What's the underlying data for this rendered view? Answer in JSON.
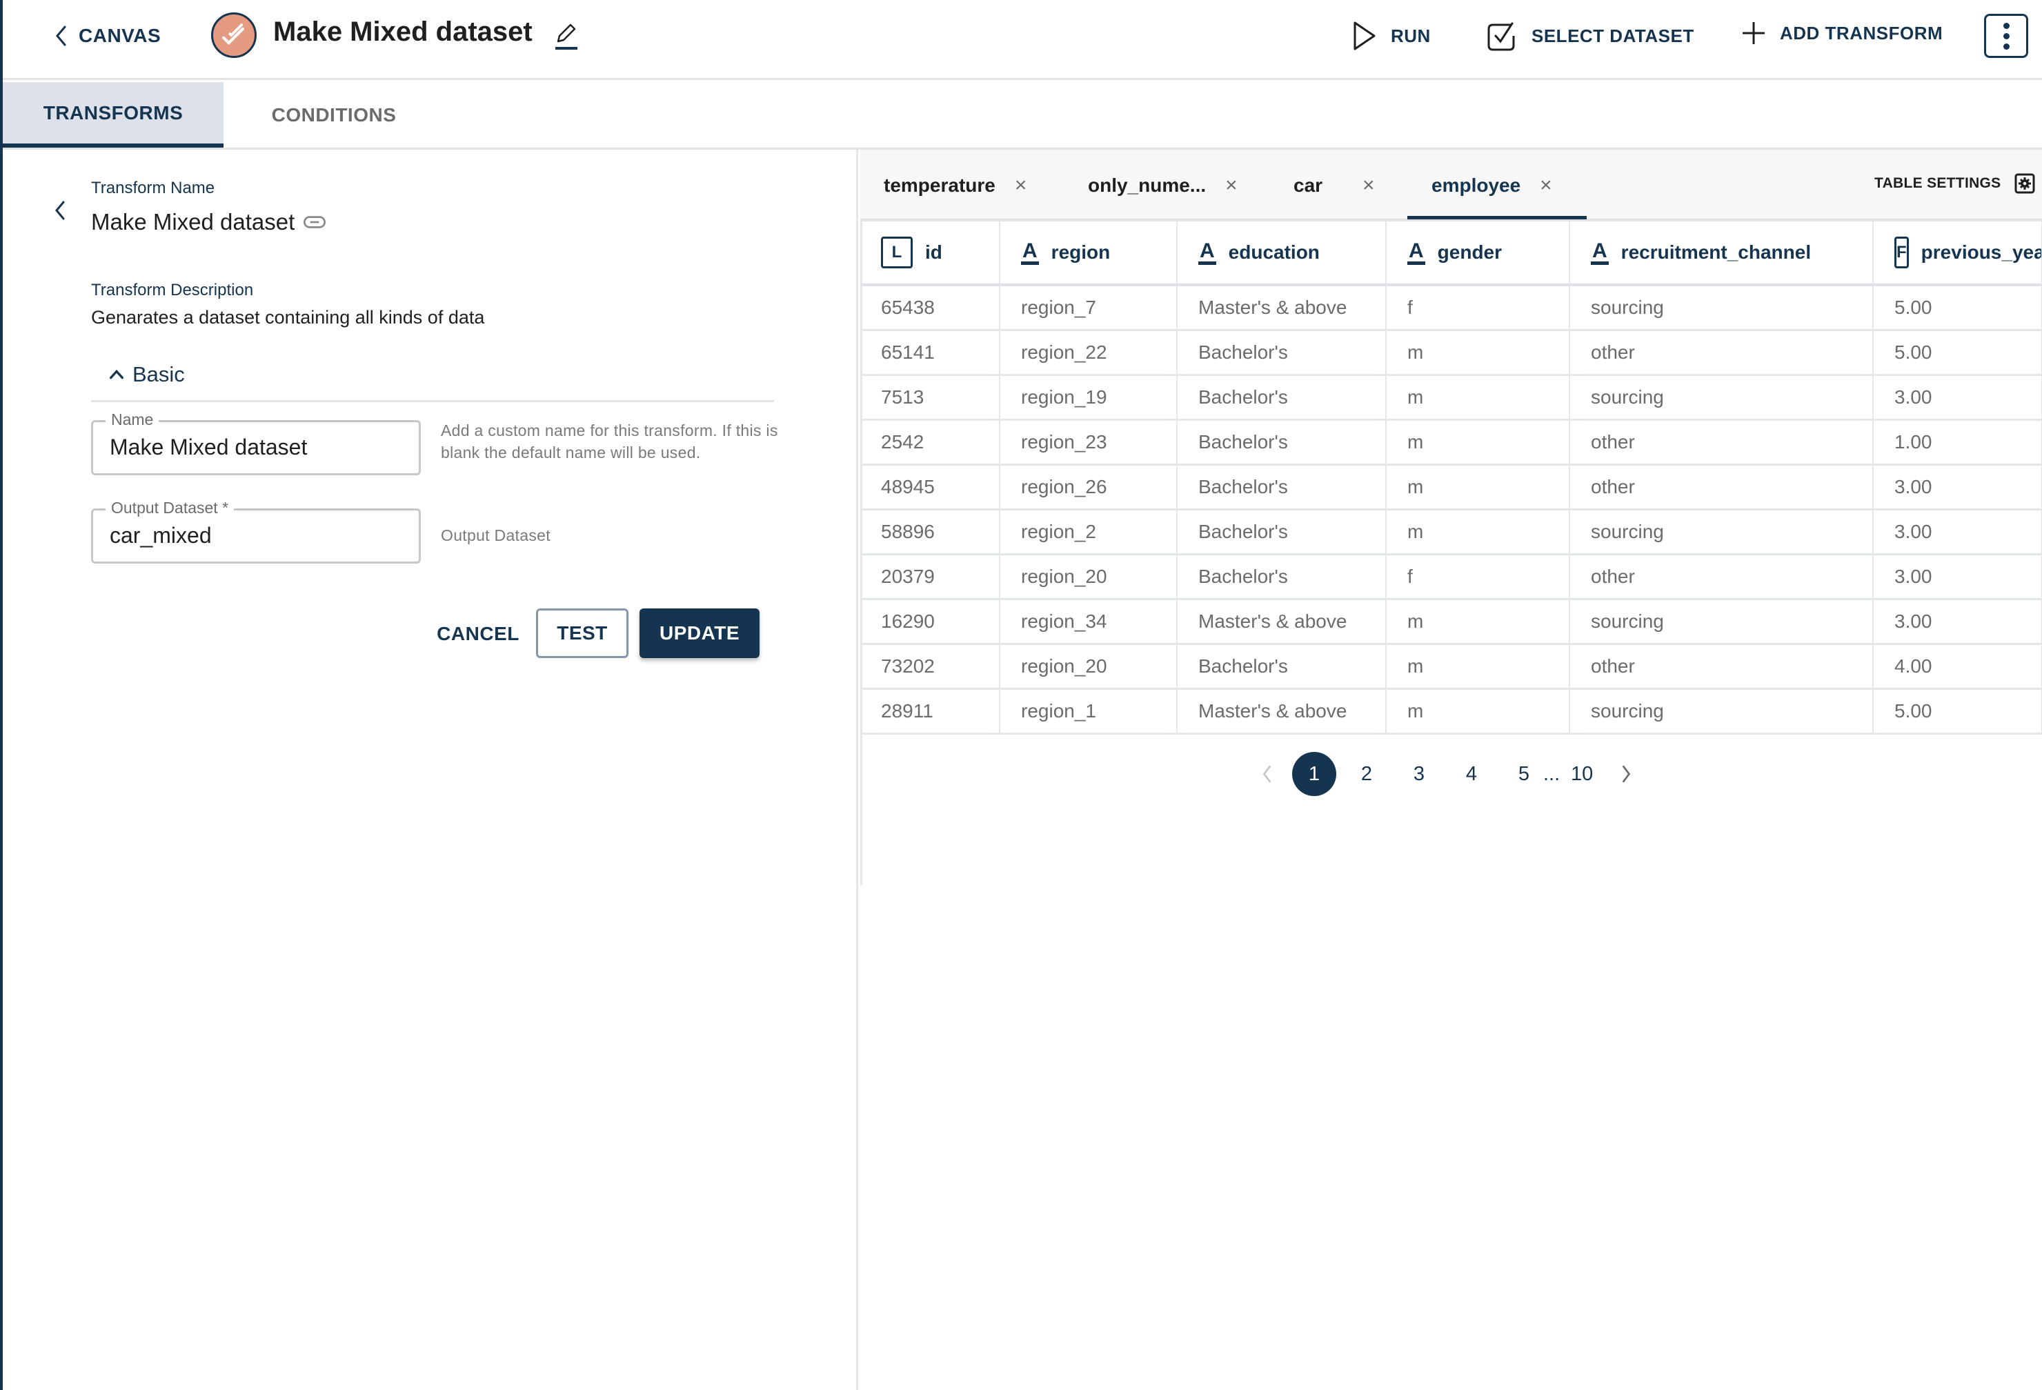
{
  "header": {
    "back_label": "CANVAS",
    "title": "Make Mixed dataset",
    "actions": {
      "run": "RUN",
      "select_dataset": "SELECT DATASET",
      "add_transform": "ADD TRANSFORM"
    },
    "logo_color": "#e59a82",
    "accent_color": "#15344f"
  },
  "main_tabs": [
    {
      "label": "TRANSFORMS",
      "active": true
    },
    {
      "label": "CONDITIONS",
      "active": false
    }
  ],
  "transform": {
    "name_label": "Transform Name",
    "name_value": "Make Mixed dataset",
    "description_label": "Transform Description",
    "description_value": "Genarates a dataset containing all kinds of data",
    "section_label": "Basic",
    "fields": {
      "name": {
        "label": "Name",
        "value": "Make Mixed dataset",
        "helper": "Add a custom name for this transform. If this is blank the default name will be used."
      },
      "output_dataset": {
        "label": "Output Dataset *",
        "value": "car_mixed",
        "helper": "Output Dataset"
      }
    },
    "buttons": {
      "cancel": "CANCEL",
      "test": "TEST",
      "update": "UPDATE"
    }
  },
  "dataset_tabs": [
    {
      "label": "temperature",
      "active": false
    },
    {
      "label": "only_nume...",
      "active": false
    },
    {
      "label": "car",
      "active": false
    },
    {
      "label": "employee",
      "active": true
    }
  ],
  "table_settings_label": "TABLE SETTINGS",
  "table": {
    "columns": [
      {
        "name": "id",
        "type": "L"
      },
      {
        "name": "region",
        "type": "A"
      },
      {
        "name": "education",
        "type": "A"
      },
      {
        "name": "gender",
        "type": "A"
      },
      {
        "name": "recruitment_channel",
        "type": "A"
      },
      {
        "name": "previous_yea",
        "type": "F"
      }
    ],
    "rows": [
      [
        "65438",
        "region_7",
        "Master's & above",
        "f",
        "sourcing",
        "5.00"
      ],
      [
        "65141",
        "region_22",
        "Bachelor's",
        "m",
        "other",
        "5.00"
      ],
      [
        "7513",
        "region_19",
        "Bachelor's",
        "m",
        "sourcing",
        "3.00"
      ],
      [
        "2542",
        "region_23",
        "Bachelor's",
        "m",
        "other",
        "1.00"
      ],
      [
        "48945",
        "region_26",
        "Bachelor's",
        "m",
        "other",
        "3.00"
      ],
      [
        "58896",
        "region_2",
        "Bachelor's",
        "m",
        "sourcing",
        "3.00"
      ],
      [
        "20379",
        "region_20",
        "Bachelor's",
        "f",
        "other",
        "3.00"
      ],
      [
        "16290",
        "region_34",
        "Master's & above",
        "m",
        "sourcing",
        "3.00"
      ],
      [
        "73202",
        "region_20",
        "Bachelor's",
        "m",
        "other",
        "4.00"
      ],
      [
        "28911",
        "region_1",
        "Master's & above",
        "m",
        "sourcing",
        "5.00"
      ]
    ]
  },
  "pagination": {
    "pages": [
      "1",
      "2",
      "3",
      "4",
      "5"
    ],
    "ellipsis": "...",
    "last_page": "10",
    "current": "1"
  }
}
